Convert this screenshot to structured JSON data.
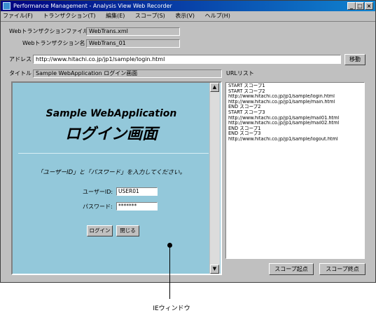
{
  "window": {
    "title": "Performance Management - Analysis View  Web Recorder",
    "controls": [
      "_",
      "□",
      "×"
    ]
  },
  "menu": [
    "ファイル(F)",
    "トランザクション(T)",
    "編集(E)",
    "スコープ(S)",
    "表示(V)",
    "ヘルプ(H)"
  ],
  "form": {
    "file_label": "Webトランザクションファイル名",
    "file_value": "WebTrans.xml",
    "txn_label": "Webトランザクション名",
    "txn_value": "WebTrans_01",
    "address_label": "アドレス",
    "address_value": "http://www.hitachi.co.jp/jp1/sample/login.html",
    "go_button": "移動",
    "title_label": "タイトル",
    "title_value": "Sample WebApplication ログイン画面",
    "urllist_label": "URLリスト"
  },
  "ie_page": {
    "heading_en": "Sample WebApplication",
    "heading_ja": "ログイン画面",
    "instruction": "「ユーザーID」と「パスワード」を入力してください。",
    "user_label": "ユーザーID:",
    "user_value": "USER01",
    "password_label": "パスワード:",
    "password_value": "*******",
    "login_button": "ログイン",
    "close_button": "閉じる"
  },
  "url_list": [
    "START スコープ1",
    "START スコープ2",
    "http://www.hitachi.co.jp/jp1/sample/login.html",
    "http://www.hitachi.co.jp/jp1/sample/main.html",
    "END スコープ2",
    "START スコープ3",
    "http://www.hitachi.co.jp/jp1/sample/mail01.html",
    "http://www.hitachi.co.jp/jp1/sample/mail02.html",
    "END スコープ1",
    "END スコープ3",
    "http://www.hitachi.co.jp/jp1/sample/logout.html"
  ],
  "buttons": {
    "scope_start": "スコープ起点",
    "scope_end": "スコープ終点"
  },
  "callout": "IEウィンドウ",
  "colors": {
    "ie_background": "#93c8da",
    "titlebar": "#000080"
  }
}
